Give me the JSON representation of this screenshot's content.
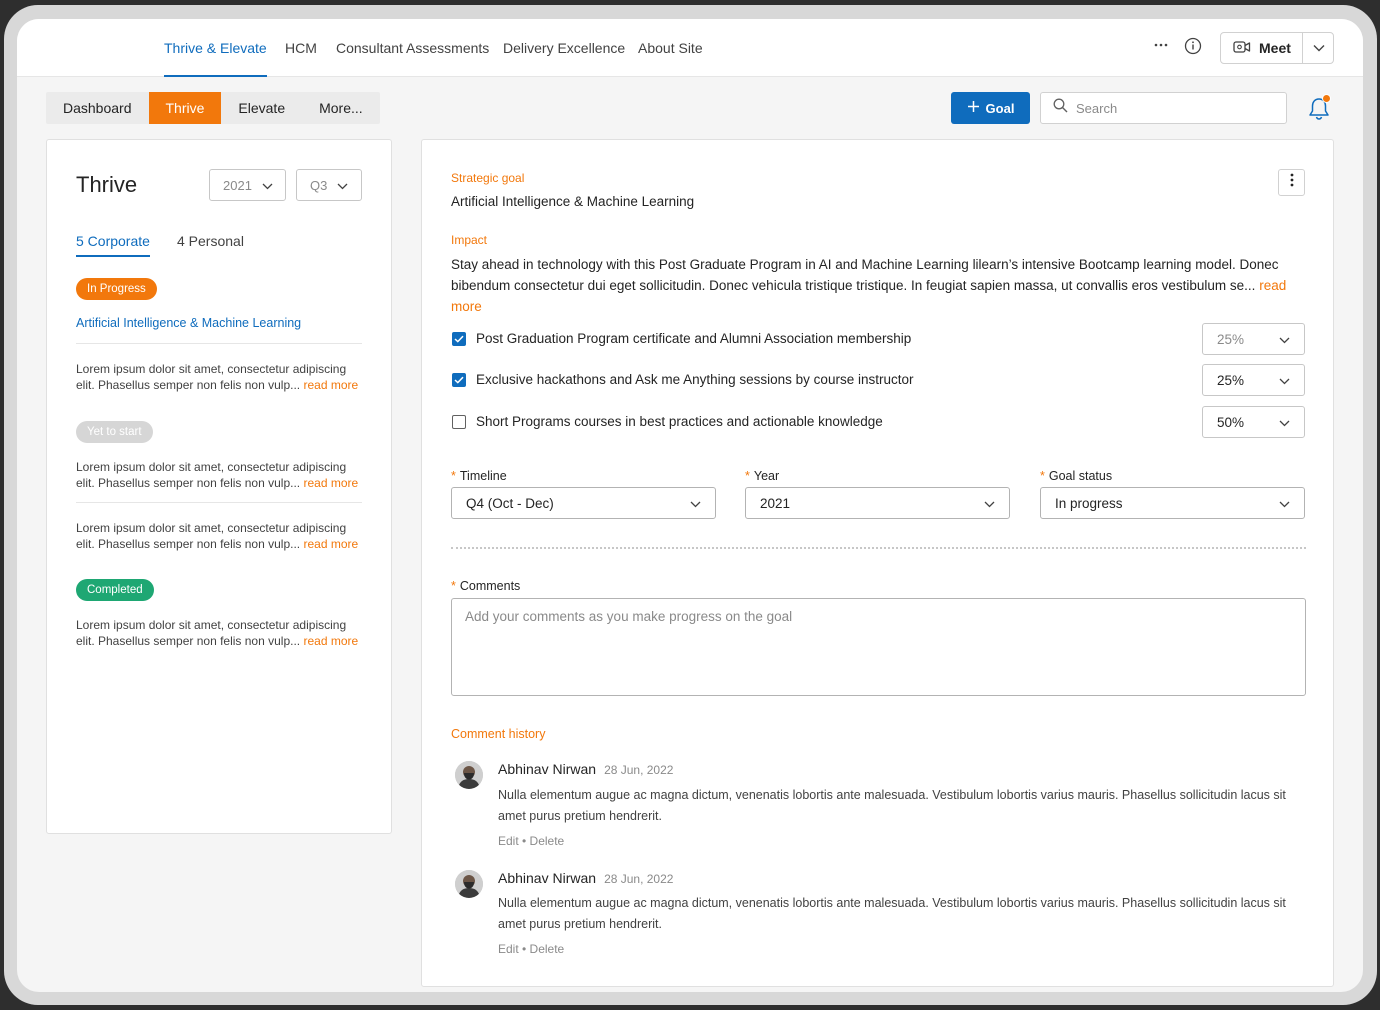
{
  "nav": {
    "tabs": [
      {
        "label": "Thrive & Elevate"
      },
      {
        "label": "HCM"
      },
      {
        "label": "Consultant Assessments"
      },
      {
        "label": "Delivery Excellence"
      },
      {
        "label": "About Site"
      }
    ],
    "more_icon": "ellipsis-icon",
    "info_icon": "info-icon",
    "meet_label": "Meet",
    "accent": "#0f6cbd"
  },
  "toolbar": {
    "tabs": [
      {
        "label": "Dashboard"
      },
      {
        "label": "Thrive"
      },
      {
        "label": "Elevate"
      },
      {
        "label": "More..."
      }
    ],
    "active_tab": "Thrive",
    "active_color": "#f2780c",
    "goal_label": "Goal",
    "search_placeholder": "Search"
  },
  "left": {
    "title": "Thrive",
    "year": "2021",
    "quarter": "Q3",
    "tab_corporate": "5 Corporate",
    "tab_personal": "4 Personal",
    "groups": [
      {
        "status": "In Progress",
        "status_color": "#f2780c"
      },
      {
        "status": "Yet to start",
        "status_color": "#d1d1d1"
      },
      {
        "status": "Completed",
        "status_color": "#13a10e"
      }
    ],
    "link": "Artificial Intelligence & Machine Learning",
    "desc_line1": "Lorem ipsum dolor sit amet, consectetur adipiscing",
    "desc_line2": "elit. Phasellus semper non felis non vulp...",
    "read_more": "read more"
  },
  "detail": {
    "strategic_label": "Strategic goal",
    "strategic_value": "Artificial Intelligence & Machine Learning",
    "impact_label": "Impact",
    "impact_text": "Stay ahead in technology with this Post Graduate Program in AI and Machine Learning lilearn’s intensive Bootcamp learning model. Donec bibendum consectetur dui eget sollicitudin. Donec vehicula tristique tristique. In feugiat sapien massa, ut convallis eros vestibulum se...",
    "read_more": "read more",
    "checklist": [
      {
        "label": "Post Graduation Program certificate and Alumni Association membership",
        "checked": true,
        "pct": "25%"
      },
      {
        "label": "Exclusive hackathons and Ask me Anything sessions by course instructor",
        "checked": true,
        "pct": "25%"
      },
      {
        "label": "Short Programs courses in best practices and actionable knowledge",
        "checked": false,
        "pct": "50%"
      }
    ],
    "timeline_label": "Timeline",
    "timeline_value": "Q4 (Oct - Dec)",
    "year_label": "Year",
    "year_value": "2021",
    "status_label": "Goal status",
    "status_value": "In progress",
    "comments_label": "Comments",
    "comments_placeholder": "Add your comments as you make progress on the goal",
    "history_label": "Comment history",
    "comments": [
      {
        "author": "Abhinav Nirwan",
        "date": "28 Jun, 2022",
        "body": "Nulla elementum augue ac magna dictum, venenatis lobortis ante malesuada. Vestibulum lobortis varius mauris. Phasellus sollicitudin lacus sit amet purus pretium hendrerit.",
        "actions": "Edit • Delete"
      },
      {
        "author": "Abhinav Nirwan",
        "date": "28 Jun, 2022",
        "body": "Nulla elementum augue ac magna dictum, venenatis lobortis ante malesuada. Vestibulum lobortis varius mauris. Phasellus sollicitudin lacus sit amet purus pretium hendrerit.",
        "actions": "Edit • Delete"
      }
    ]
  }
}
